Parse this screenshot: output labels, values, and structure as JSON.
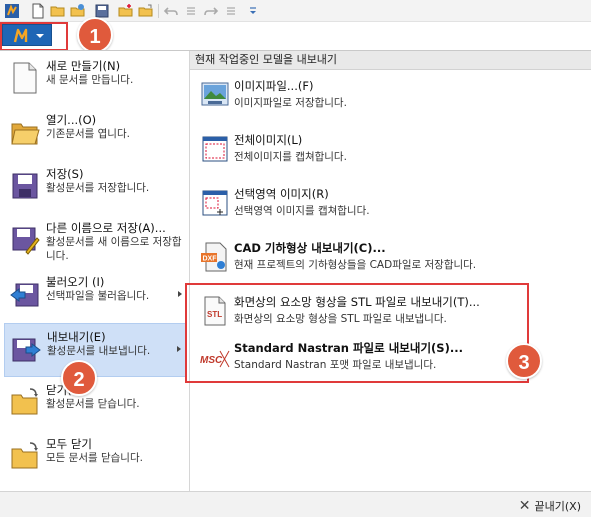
{
  "callouts": [
    "1",
    "2",
    "3"
  ],
  "qat": {
    "icons": [
      "new-doc-icon",
      "open-folder-icon",
      "open-special-icon",
      "save-icon",
      "folder-new-icon",
      "folder-icon",
      "undo-icon",
      "undo-list-icon",
      "redo-icon",
      "redo-list-icon",
      "customize-icon"
    ]
  },
  "app_button": {
    "icon": "app-logo-icon"
  },
  "left_menu": [
    {
      "title": "새로 만들기(N)",
      "desc": "새 문서를 만듭니다.",
      "icon": "new-document-icon"
    },
    {
      "title": "열기...(O)",
      "desc": "기존문서를 엽니다.",
      "icon": "open-folder-icon"
    },
    {
      "title": "저장(S)",
      "desc": "활성문서를 저장합니다.",
      "icon": "save-disk-icon"
    },
    {
      "title": "다른 이름으로 저장(A)...",
      "desc": "활성문서를 새 이름으로 저장합니다.",
      "icon": "save-as-icon"
    },
    {
      "title": "불러오기 (I)",
      "desc": "선택파일을 불러옵니다.",
      "icon": "import-icon"
    },
    {
      "title": "내보내기(E)",
      "desc": "활성문서를 내보냅니다.",
      "icon": "export-icon"
    },
    {
      "title": "닫기(C)",
      "desc": "활성문서를 닫습니다.",
      "icon": "close-folder-icon"
    },
    {
      "title": "모두 닫기",
      "desc": "모든 문서를 닫습니다.",
      "icon": "close-all-folder-icon"
    }
  ],
  "right_header": "현재 작업중인 모델을 내보내기",
  "right_menu": [
    {
      "title": "이미지파일...(F)",
      "desc": "이미지파일로 저장합니다.",
      "icon": "image-file-icon"
    },
    {
      "title": "전체이미지(L)",
      "desc": "전체이미지를 캡쳐합니다.",
      "icon": "full-capture-icon"
    },
    {
      "title": "선택영역 이미지(R)",
      "desc": "선택영역 이미지를 캡쳐합니다.",
      "icon": "region-capture-icon"
    },
    {
      "title": "CAD 기하형상 내보내기(C)...",
      "desc": "현재 프로젝트의 기하형상들을 CAD파일로 저장합니다.",
      "icon": "dxf-export-icon"
    },
    {
      "title": "화면상의 요소망 형상을 STL 파일로 내보내기(T)...",
      "desc": "화면상의 요소망 형상을 STL 파일로 내보냅니다.",
      "icon": "stl-file-icon"
    },
    {
      "title": "Standard Nastran 파일로 내보내기(S)...",
      "desc": "Standard Nastran 포맷 파일로 내보냅니다.",
      "icon": "msc-nastran-icon"
    }
  ],
  "footer": {
    "exit_label": "끝내기(X)"
  },
  "colors": {
    "accent": "#1f66b5",
    "selected": "#cfe0f7",
    "callout": "#e05a3c",
    "highlight_box": "#e03a3a"
  }
}
